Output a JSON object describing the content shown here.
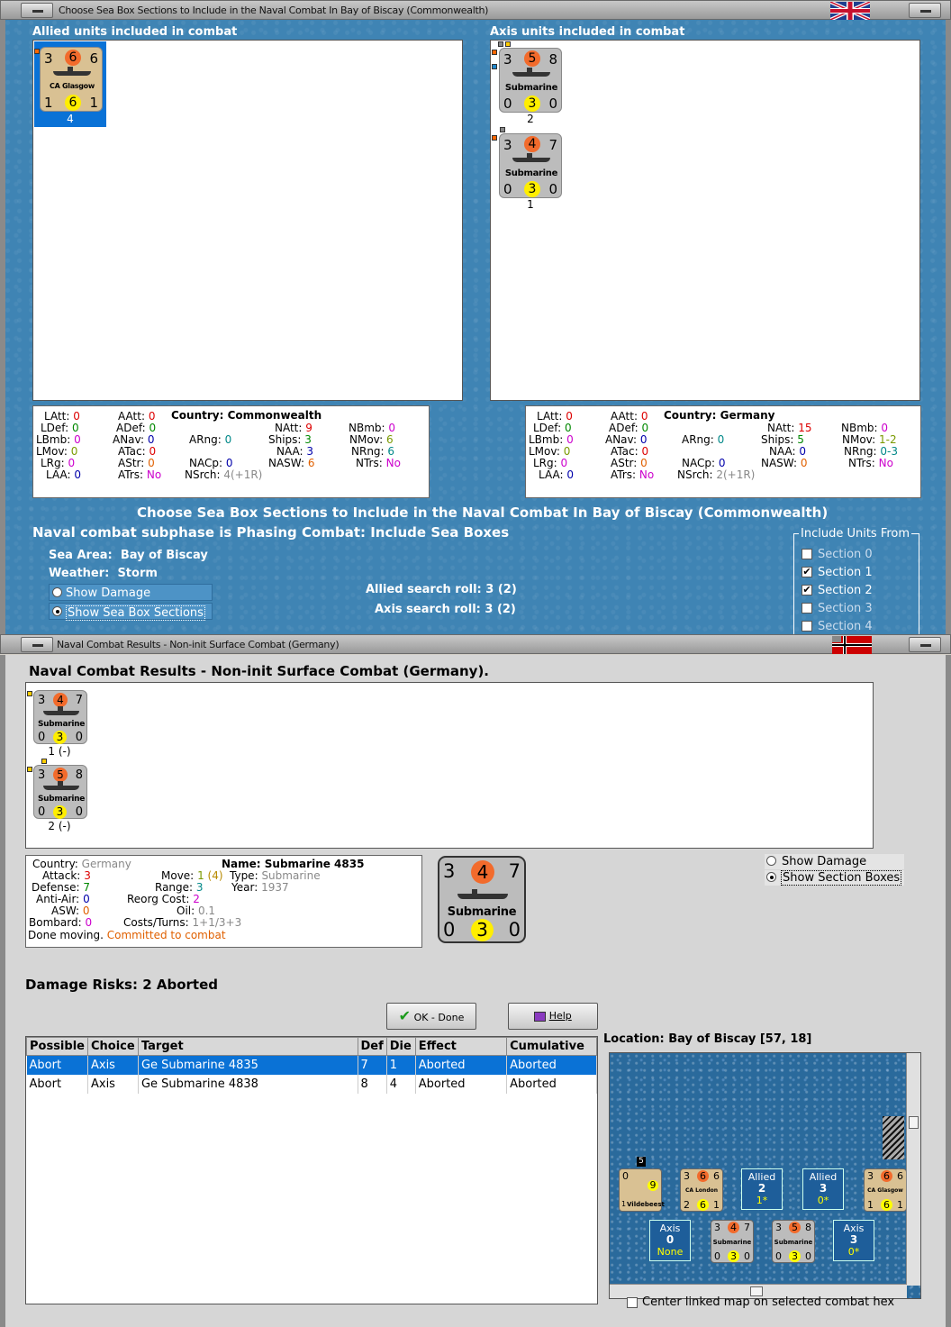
{
  "window1": {
    "title": "Choose Sea Box Sections to Include in the Naval Combat In Bay of Biscay (Commonwealth)",
    "allied_label": "Allied units included in combat",
    "axis_label": "Axis units included in combat",
    "allied_units": [
      {
        "att": "3",
        "mid": "6",
        "def": "6",
        "name": "CA Glasgow",
        "bl": "1",
        "yel": "6",
        "br": "1",
        "section": "4"
      }
    ],
    "axis_units": [
      {
        "att": "3",
        "mid": "5",
        "def": "8",
        "name": "Submarine",
        "bl": "0",
        "yel": "3",
        "br": "0",
        "section": "2"
      },
      {
        "att": "3",
        "mid": "4",
        "def": "7",
        "name": "Submarine",
        "bl": "0",
        "yel": "3",
        "br": "0",
        "section": "1"
      }
    ],
    "allied_stats": {
      "country_label": "Country:",
      "country": "Commonwealth",
      "LAtt": "0",
      "AAtt": "0",
      "LDef": "0",
      "ADef": "0",
      "LBmb": "0",
      "ANav": "0",
      "LMov": "0",
      "ATac": "0",
      "LRg": "0",
      "AStr": "0",
      "LAA": "0",
      "ATrs": "No",
      "ARng": "0",
      "NACp": "0",
      "NSrch": "4(+1R)",
      "NAtt": "9",
      "Ships": "3",
      "NAA": "3",
      "NASW": "6",
      "NBmb": "0",
      "NMov": "6",
      "NRng": "6",
      "NTrs": "No"
    },
    "axis_stats": {
      "country_label": "Country:",
      "country": "Germany",
      "LAtt": "0",
      "AAtt": "0",
      "LDef": "0",
      "ADef": "0",
      "LBmb": "0",
      "ANav": "0",
      "LMov": "0",
      "ATac": "0",
      "LRg": "0",
      "AStr": "0",
      "LAA": "0",
      "ATrs": "No",
      "ARng": "0",
      "NACp": "0",
      "NSrch": "2(+1R)",
      "NAtt": "15",
      "Ships": "5",
      "NAA": "0",
      "NASW": "0",
      "NBmb": "0",
      "NMov": "1-2",
      "NRng": "0-3",
      "NTrs": "No"
    },
    "heading": "Choose Sea Box Sections to Include in the Naval Combat In Bay of Biscay (Commonwealth)",
    "subphase": "Naval combat subphase is Phasing Combat: Include Sea Boxes",
    "sea_area_label": "Sea Area:",
    "sea_area": "Bay of Biscay",
    "weather_label": "Weather:",
    "weather": "Storm",
    "show_damage": "Show Damage",
    "show_sections": "Show Sea Box Sections",
    "allied_roll": "Allied search roll: 3 (2)",
    "axis_roll": "Axis search roll: 3 (2)",
    "include_title": "Include Units From",
    "sections": [
      "Section 0",
      "Section 1",
      "Section 2",
      "Section 3",
      "Section 4"
    ],
    "section_checked": [
      false,
      true,
      true,
      false,
      false
    ]
  },
  "window2": {
    "title": "Naval Combat Results - Non-init Surface Combat (Germany)",
    "heading": "Naval Combat Results - Non-init Surface Combat (Germany).",
    "units": [
      {
        "att": "3",
        "mid": "4",
        "def": "7",
        "name": "Submarine",
        "bl": "0",
        "yel": "3",
        "br": "0",
        "status": "1 (-)"
      },
      {
        "att": "3",
        "mid": "5",
        "def": "8",
        "name": "Submarine",
        "bl": "0",
        "yel": "3",
        "br": "0",
        "status": "2 (-)"
      }
    ],
    "info": {
      "country_label": "Country:",
      "country": "Germany",
      "name_label": "Name:",
      "name": "Submarine 4835",
      "attack_label": "Attack:",
      "attack": "3",
      "move_label": "Move:",
      "move": "1",
      "move_extra": "(4)",
      "type_label": "Type:",
      "type": "Submarine",
      "defense_label": "Defense:",
      "defense": "7",
      "range_label": "Range:",
      "range": "3",
      "year_label": "Year:",
      "year": "1937",
      "aa_label": "Anti-Air:",
      "aa": "0",
      "reorg_label": "Reorg Cost:",
      "reorg": "2",
      "asw_label": "ASW:",
      "asw": "0",
      "oil_label": "Oil:",
      "oil": "0.1",
      "bombard_label": "Bombard:",
      "bombard": "0",
      "costs_label": "Costs/Turns:",
      "costs": "1+1/3+3",
      "done": "Done moving.",
      "committed": "Committed to combat"
    },
    "big_counter": {
      "att": "3",
      "mid": "4",
      "def": "7",
      "name": "Submarine",
      "bl": "0",
      "yel": "3",
      "br": "0"
    },
    "show_damage": "Show Damage",
    "show_sections": "Show Section Boxes",
    "damage_risks": "Damage Risks:  2 Aborted",
    "ok_button": "OK - Done",
    "help_button": "Help",
    "columns": [
      "Possible",
      "Choice",
      "Target",
      "Def",
      "Die",
      "Effect",
      "Cumulative"
    ],
    "rows": [
      [
        "Abort",
        "Axis",
        "Ge Submarine 4835",
        "7",
        "1",
        "Aborted",
        "Aborted"
      ],
      [
        "Abort",
        "Axis",
        "Ge Submarine 4838",
        "8",
        "4",
        "Aborted",
        "Aborted"
      ]
    ],
    "location": "Location:  Bay of Biscay [57, 18]",
    "map": {
      "stack_count": "5",
      "vildebeest": "Vildebeest",
      "vil_l": "0",
      "vil_r": "9",
      "vil_bl": "1",
      "london": {
        "att": "3",
        "mid": "6",
        "def": "6",
        "name": "CA London",
        "bl": "2",
        "yel": "6",
        "br": "1"
      },
      "glasgow": {
        "att": "3",
        "mid": "6",
        "def": "6",
        "name": "CA Glasgow",
        "bl": "1",
        "yel": "6",
        "br": "1"
      },
      "allied_box1": {
        "side": "Allied",
        "num": "2",
        "sub": "1*"
      },
      "allied_box2": {
        "side": "Allied",
        "num": "3",
        "sub": "0*"
      },
      "axis_box1": {
        "side": "Axis",
        "num": "0",
        "sub": "None"
      },
      "axis_box2": {
        "side": "Axis",
        "num": "3",
        "sub": "0*"
      },
      "sub1": {
        "att": "3",
        "mid": "4",
        "def": "7",
        "name": "Submarine",
        "bl": "0",
        "yel": "3",
        "br": "0"
      },
      "sub2": {
        "att": "3",
        "mid": "5",
        "def": "8",
        "name": "Submarine",
        "bl": "0",
        "yel": "3",
        "br": "0"
      }
    },
    "center_map": "Center linked map on selected combat hex"
  }
}
